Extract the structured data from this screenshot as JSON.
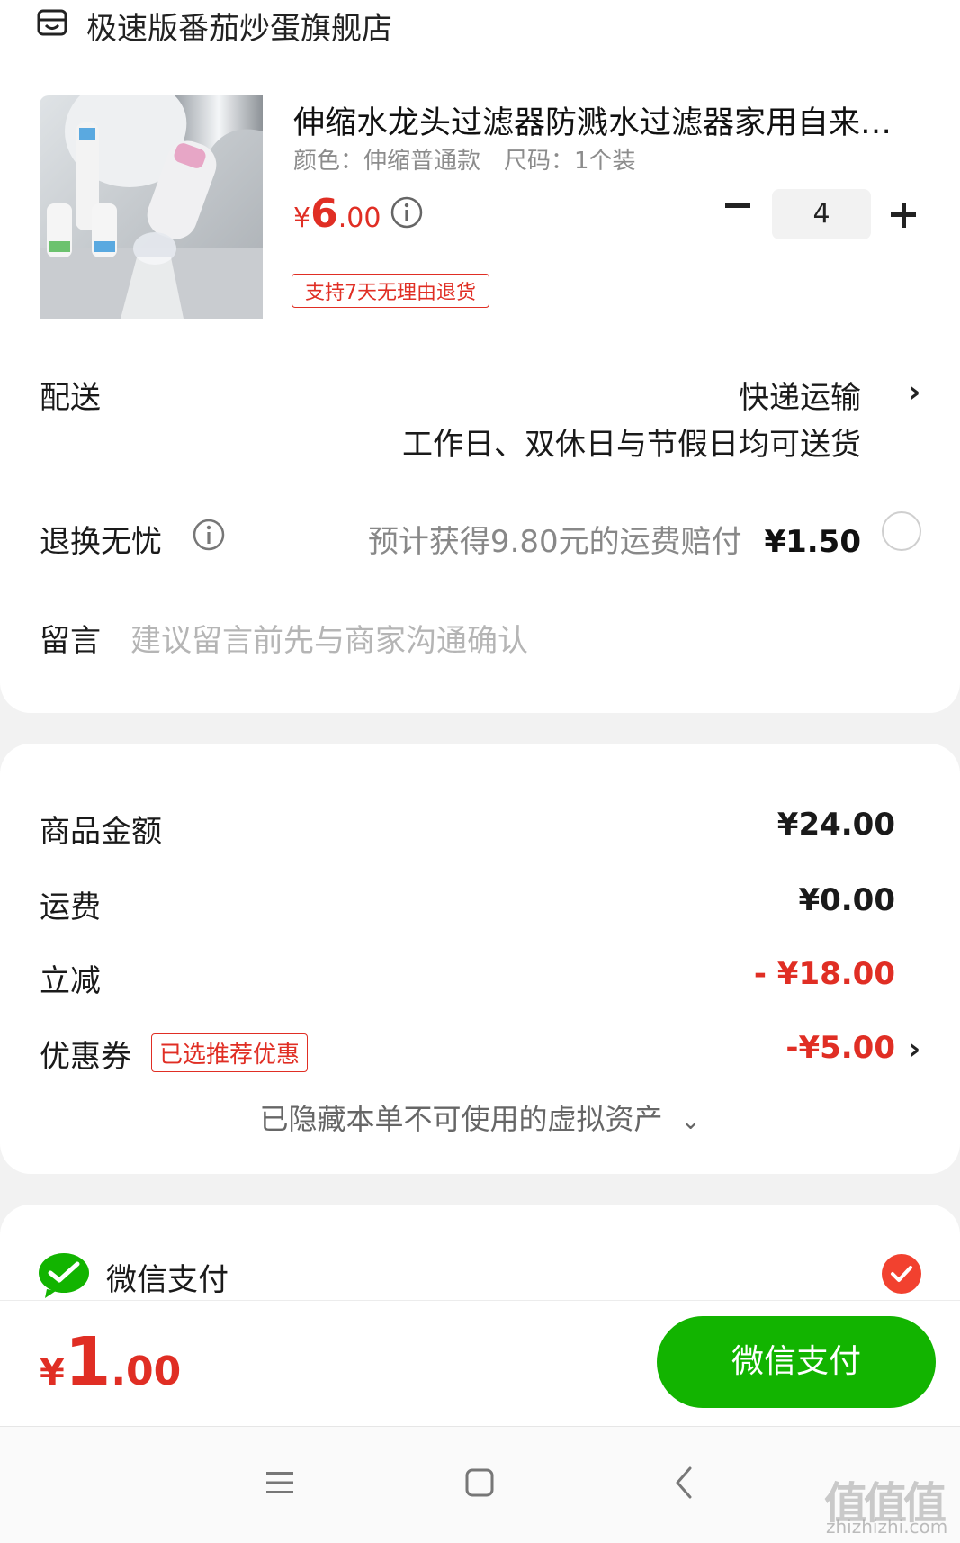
{
  "store": {
    "name": "极速版番茄炒蛋旗舰店",
    "icon": "store-icon"
  },
  "product": {
    "title": "伸缩水龙头过滤器防溅水过滤器家用自来…",
    "color": "颜色：伸缩普通款",
    "size": "尺码：1个装",
    "price_symbol": "¥",
    "price_int": "6",
    "price_dec": ".00",
    "quantity": "4",
    "return_tag": "支持7天无理由退货"
  },
  "delivery": {
    "label": "配送",
    "method": "快递运输",
    "note": "工作日、双休日与节假日均可送货",
    "chevron": "›"
  },
  "return_insurance": {
    "label": "退换无忧",
    "desc": "预计获得9.80元的运费赔付",
    "price": "¥1.50"
  },
  "message": {
    "label": "留言",
    "placeholder": "建议留言前先与商家沟通确认"
  },
  "summary": {
    "goods_label": "商品金额",
    "goods_value": "¥24.00",
    "shipping_label": "运费",
    "shipping_value": "¥0.00",
    "discount_label": "立减",
    "discount_value": "- ¥18.00",
    "coupon_label": "优惠券",
    "coupon_tag": "已选推荐优惠",
    "coupon_value": "-¥5.00",
    "hidden_assets": "已隐藏本单不可使用的虚拟资产",
    "hidden_chevron": "⌄"
  },
  "payment": {
    "method": "微信支付",
    "selected": true
  },
  "footer": {
    "total_symbol": "¥",
    "total_int": "1",
    "total_dec": ".00",
    "pay_button": "微信支付"
  },
  "watermark": {
    "text": "值值值",
    "domain": "zhizhizhi.com"
  },
  "colors": {
    "accent_red": "#e02e24",
    "wechat_green": "#12b400",
    "check_red": "#f2412f"
  }
}
